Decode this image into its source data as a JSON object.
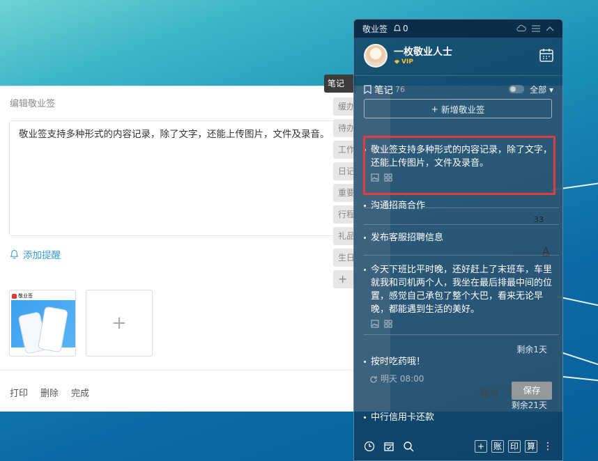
{
  "editor": {
    "title": "编辑敬业签",
    "body_text": "敬业签支持多种形式的内容记录，除了文字，还能上传图片，文件及录音。",
    "reminder_label": "添加提醒",
    "thumb_logo": "敬业签",
    "add_tile": "+",
    "footer": [
      "打印",
      "删除",
      "完成"
    ],
    "cancel_label": "取消",
    "save_label": "保存",
    "count_badge": "33",
    "font_icon": "A"
  },
  "side_tabs": [
    {
      "label": "笔记",
      "active": true
    },
    {
      "label": "缓办",
      "active": false
    },
    {
      "label": "待办",
      "active": false
    },
    {
      "label": "工作",
      "active": false
    },
    {
      "label": "日记",
      "active": false
    },
    {
      "label": "重要",
      "active": false
    },
    {
      "label": "行程",
      "active": false
    },
    {
      "label": "礼品",
      "active": false
    },
    {
      "label": "生日",
      "active": false
    },
    {
      "label": "+",
      "active": false
    }
  ],
  "panel": {
    "app_name": "敬业签",
    "bell_count": "0",
    "username": "一枚敬业人士",
    "vip_label": "VIP",
    "notes_title": "笔记",
    "notes_count": "76",
    "filter_label": "全部",
    "new_note_label": "新增敬业签",
    "notes": [
      {
        "text": "敬业签支持多种形式的内容记录，除了文字，还能上传图片，文件及录音。",
        "has_meta": true
      },
      {
        "text": "沟通招商合作",
        "has_meta": false
      },
      {
        "text": "发布客服招聘信息",
        "has_meta": false
      },
      {
        "text": "今天下班比平时晚，还好赶上了末班车，车里就我和司机两个人，我坐在最后排最中间的位置，感觉自己承包了整个大巴，看来无论早晚，都能遇到生活的美好。",
        "has_meta": true
      },
      {
        "text": "按时吃药哦！",
        "has_meta": false,
        "remain": "剩余1天",
        "schedule": "明天 08:00"
      },
      {
        "text": "中行信用卡还款",
        "has_meta": false,
        "remain": "剩余21天"
      }
    ],
    "footer_boxes": [
      "+",
      "账",
      "印",
      "算"
    ]
  },
  "colors": {
    "highlight": "#e63b3b",
    "accent_blue": "#3d9bd9",
    "vip_gold": "#f3c332"
  }
}
